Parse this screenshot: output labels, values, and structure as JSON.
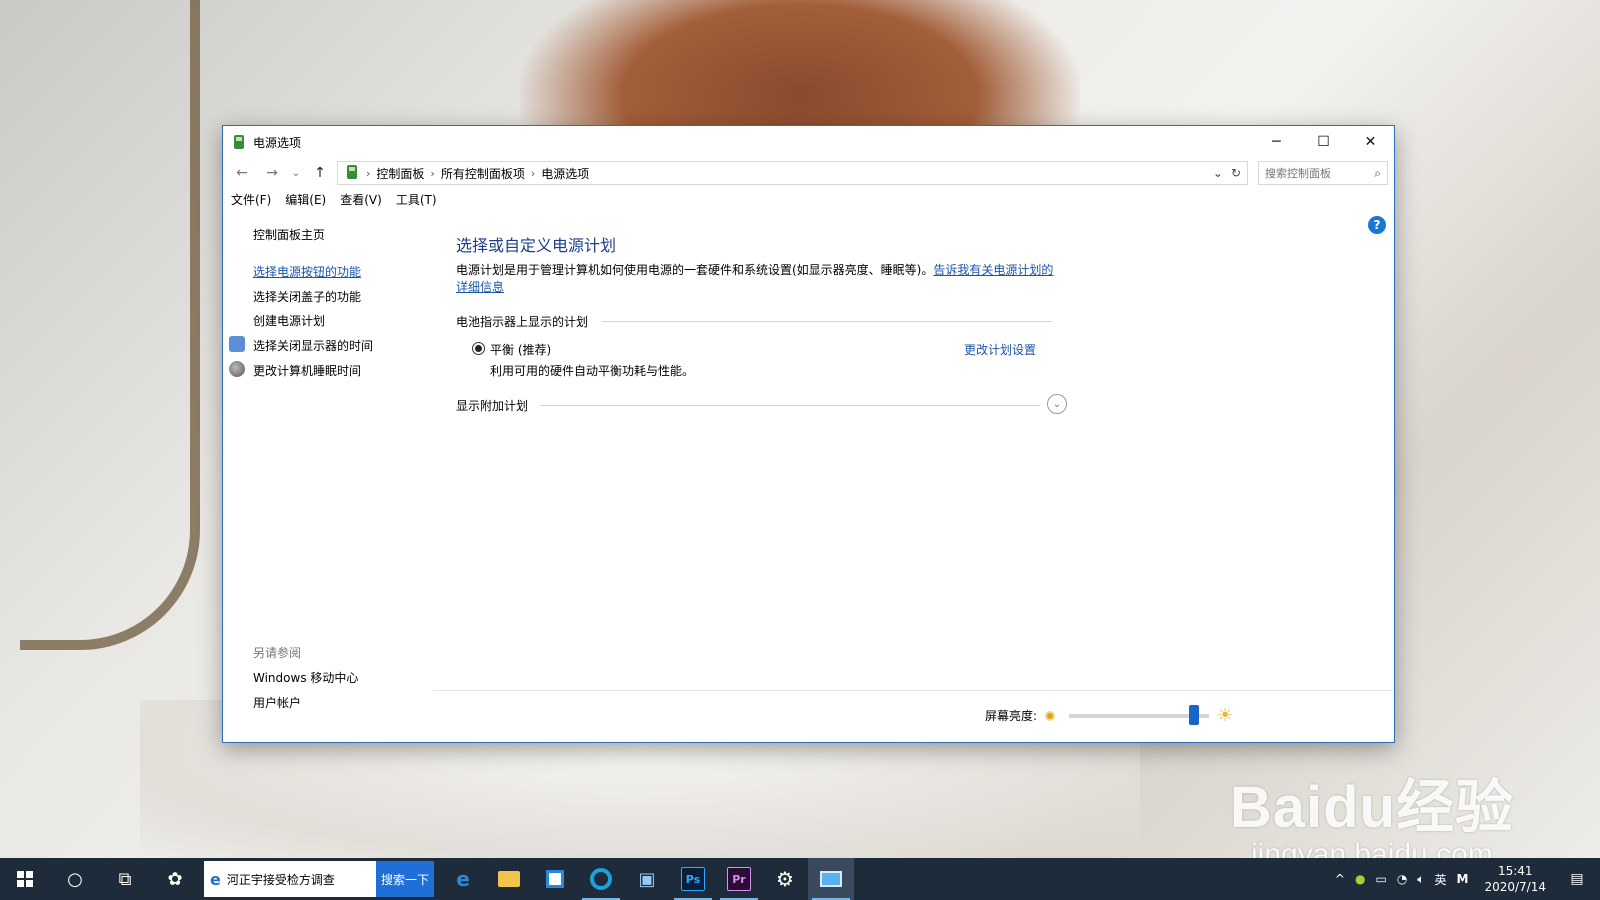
{
  "window": {
    "title": "电源选项",
    "controls": {
      "minimize": "─",
      "maximize": "☐",
      "close": "✕"
    }
  },
  "address": {
    "breadcrumbs": [
      "控制面板",
      "所有控制面板项",
      "电源选项"
    ],
    "search_placeholder": "搜索控制面板"
  },
  "menu": [
    "文件(F)",
    "编辑(E)",
    "查看(V)",
    "工具(T)"
  ],
  "sidebar": {
    "home": "控制面板主页",
    "links": [
      "选择电源按钮的功能",
      "选择关闭盖子的功能",
      "创建电源计划",
      "选择关闭显示器的时间",
      "更改计算机睡眠时间"
    ],
    "see_also_title": "另请参阅",
    "see_also": [
      "Windows 移动中心",
      "用户帐户"
    ]
  },
  "main": {
    "heading": "选择或自定义电源计划",
    "description": "电源计划是用于管理计算机如何使用电源的一套硬件和系统设置(如显示器亮度、睡眠等)。",
    "description_link": "告诉我有关电源计划的详细信息",
    "battery_group_title": "电池指示器上显示的计划",
    "plan": {
      "name": "平衡 (推荐)",
      "description": "利用可用的硬件自动平衡功耗与性能。",
      "selected": true,
      "change_link": "更改计划设置"
    },
    "additional_plans": "显示附加计划"
  },
  "footer": {
    "brightness_label": "屏幕亮度:",
    "brightness_value": 0.92
  },
  "taskbar": {
    "search_text": "河正宇接受检方调查",
    "search_button": "搜索一下",
    "apps": [
      "Ps",
      "Pr"
    ],
    "tray": {
      "ime": "英",
      "input_mode": "M"
    },
    "time": "15:41",
    "date": "2020/7/14"
  },
  "watermark": {
    "brand": "Baidu经验",
    "url": "jingyan.baidu.com"
  },
  "colors": {
    "accent": "#1a56a8",
    "heading": "#1d3f8a",
    "taskbar": "#1e2b3a",
    "slider": "#1765c7"
  }
}
